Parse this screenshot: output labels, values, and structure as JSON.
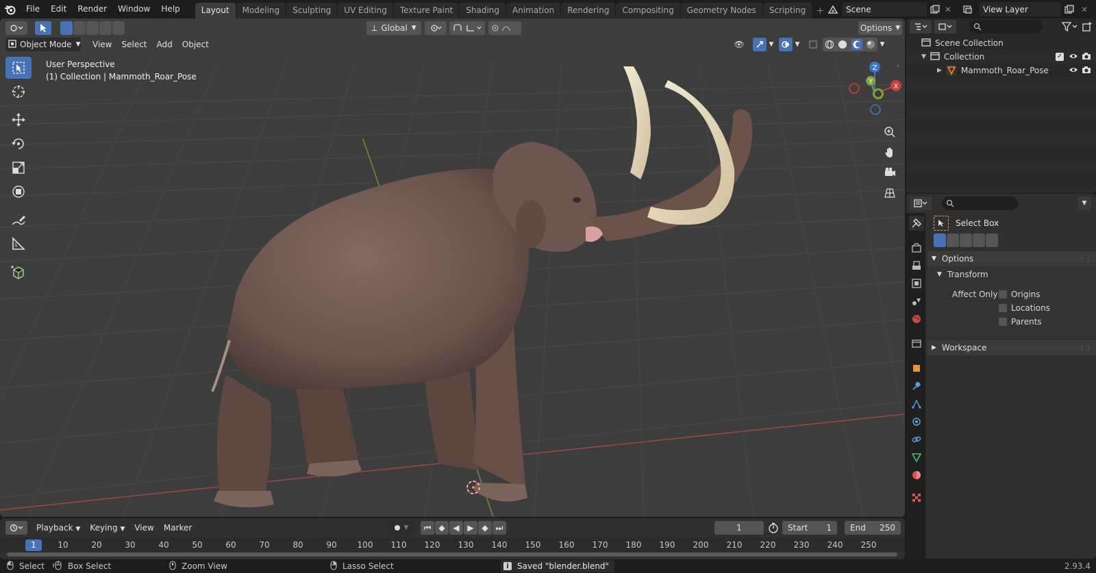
{
  "menubar": {
    "items": [
      "File",
      "Edit",
      "Render",
      "Window",
      "Help"
    ]
  },
  "workspaces": {
    "tabs": [
      "Layout",
      "Modeling",
      "Sculpting",
      "UV Editing",
      "Texture Paint",
      "Shading",
      "Animation",
      "Rendering",
      "Compositing",
      "Geometry Nodes",
      "Scripting"
    ],
    "active": "Layout"
  },
  "scene": {
    "name": "Scene"
  },
  "view_layer": {
    "name": "View Layer"
  },
  "viewport": {
    "transform_orientation": "Global",
    "options_label": "Options",
    "mode": "Object Mode",
    "menus": [
      "View",
      "Select",
      "Add",
      "Object"
    ],
    "info_line1": "User Perspective",
    "info_line2": "(1) Collection | Mammoth_Roar_Pose",
    "gizmo": {
      "z": "Z",
      "y": "Y",
      "x": "X"
    }
  },
  "timeline": {
    "menus": [
      "Playback",
      "Keying",
      "View",
      "Marker"
    ],
    "current_frame": "1",
    "start_label": "Start",
    "start_value": "1",
    "end_label": "End",
    "end_value": "250",
    "ruler_ticks": [
      "1",
      "10",
      "20",
      "30",
      "40",
      "50",
      "60",
      "70",
      "80",
      "90",
      "100",
      "110",
      "120",
      "130",
      "140",
      "150",
      "160",
      "170",
      "180",
      "190",
      "200",
      "210",
      "220",
      "230",
      "240",
      "250"
    ]
  },
  "outliner": {
    "root": "Scene Collection",
    "collection": "Collection",
    "object": "Mammoth_Roar_Pose"
  },
  "properties": {
    "tool_name": "Select Box",
    "options_panel": "Options",
    "transform_subpanel": "Transform",
    "affect_only_label": "Affect Only",
    "affect_options": [
      "Origins",
      "Locations",
      "Parents"
    ],
    "workspace_panel": "Workspace"
  },
  "statusbar": {
    "select": "Select",
    "box_select": "Box Select",
    "zoom_view": "Zoom View",
    "lasso_select": "Lasso Select",
    "message": "Saved \"blender.blend\"",
    "version": "2.93.4"
  },
  "colors": {
    "accent": "#4772b3",
    "viewport_bg": "#3d3d3d",
    "x_axis": "#c8403f",
    "y_axis": "#7ea43c",
    "z_axis": "#3b76c7",
    "mammoth_body": "#6e5750",
    "tusk": "#e6dcc0"
  }
}
